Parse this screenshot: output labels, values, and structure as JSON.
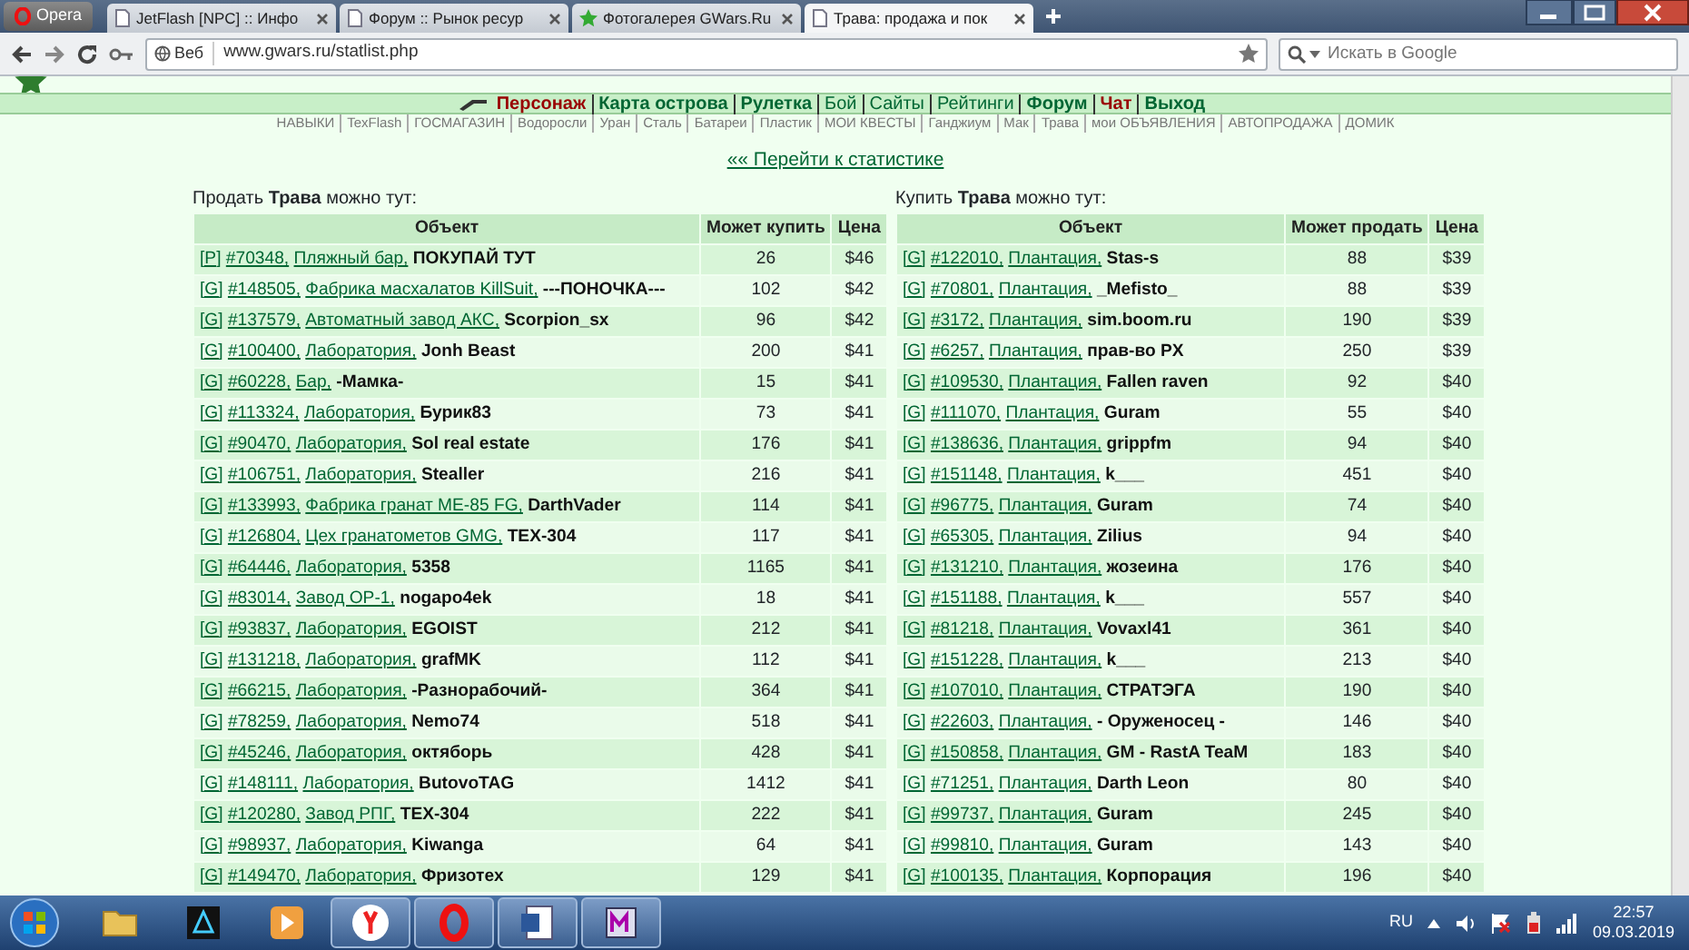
{
  "browser": {
    "opera_button": "Opera",
    "tabs": [
      {
        "title": "JetFlash [NPC] :: Инфо",
        "kind": "page",
        "selected": false
      },
      {
        "title": "Форум :: Рынок ресур",
        "kind": "page",
        "selected": false
      },
      {
        "title": "Фотогалерея GWars.Ru",
        "kind": "star",
        "selected": false
      },
      {
        "title": "Трава: продажа и пок",
        "kind": "page",
        "selected": true
      }
    ],
    "address": {
      "badge": "Веб",
      "url": "www.gwars.ru/statlist.php"
    },
    "search": {
      "placeholder": "Искать в Google"
    }
  },
  "nav": {
    "main": [
      {
        "label": "Персонаж",
        "kind": "alert"
      },
      {
        "label": "Карта острова",
        "kind": "main"
      },
      {
        "label": "Рулетка",
        "kind": "main"
      },
      {
        "label": "Бой",
        "kind": "minor"
      },
      {
        "label": "Сайты",
        "kind": "minor"
      },
      {
        "label": "Рейтинги",
        "kind": "minor"
      },
      {
        "label": "Форум",
        "kind": "main"
      },
      {
        "label": "Чат",
        "kind": "alert"
      },
      {
        "label": "Выход",
        "kind": "main"
      }
    ],
    "sub": [
      "НАВЫКИ",
      "TexFlash",
      "ГОСМАГАЗИН",
      "Водоросли",
      "Уран",
      "Сталь",
      "Батареи",
      "Пластик",
      "МОИ КВЕСТЫ",
      "Ганджиум",
      "Мак",
      "Трава",
      "мои ОБЪЯВЛЕНИЯ",
      "АВТОПРОДАЖА",
      "ДОМИК"
    ]
  },
  "stats_link": "«« Перейти к статистике",
  "sell": {
    "heading": "Продать **Трава** можно тут:",
    "columns": [
      "Объект",
      "Может купить",
      "Цена"
    ],
    "rows": [
      {
        "tag": "[P]",
        "id": "#70348,",
        "place": "Пляжный бар,",
        "owner": "ПОКУПАЙ ТУТ",
        "count": "26",
        "price": "$46"
      },
      {
        "tag": "[G]",
        "id": "#148505,",
        "place": "Фабрика масхалатов KillSuit,",
        "owner": "---ПОНОЧКА---",
        "count": "102",
        "price": "$42"
      },
      {
        "tag": "[G]",
        "id": "#137579,",
        "place": "Автоматный завод АКС,",
        "owner": "Scorpion_sx",
        "count": "96",
        "price": "$42"
      },
      {
        "tag": "[G]",
        "id": "#100400,",
        "place": "Лаборатория,",
        "owner": "Jonh Beast",
        "count": "200",
        "price": "$41"
      },
      {
        "tag": "[G]",
        "id": "#60228,",
        "place": "Бар,",
        "owner": "-Мамка-",
        "count": "15",
        "price": "$41"
      },
      {
        "tag": "[G]",
        "id": "#113324,",
        "place": "Лаборатория,",
        "owner": "Бурик83",
        "count": "73",
        "price": "$41"
      },
      {
        "tag": "[G]",
        "id": "#90470,",
        "place": "Лаборатория,",
        "owner": "Sol real estate",
        "count": "176",
        "price": "$41"
      },
      {
        "tag": "[G]",
        "id": "#106751,",
        "place": "Лаборатория,",
        "owner": "Stealler",
        "count": "216",
        "price": "$41"
      },
      {
        "tag": "[G]",
        "id": "#133993,",
        "place": "Фабрика гранат МЕ-85 FG,",
        "owner": "DarthVader",
        "count": "114",
        "price": "$41"
      },
      {
        "tag": "[G]",
        "id": "#126804,",
        "place": "Цех гранатометов GMG,",
        "owner": "TEX-304",
        "count": "117",
        "price": "$41"
      },
      {
        "tag": "[G]",
        "id": "#64446,",
        "place": "Лаборатория,",
        "owner": "5358",
        "count": "1165",
        "price": "$41"
      },
      {
        "tag": "[G]",
        "id": "#83014,",
        "place": "Завод ОР-1,",
        "owner": "nogapo4ek",
        "count": "18",
        "price": "$41"
      },
      {
        "tag": "[G]",
        "id": "#93837,",
        "place": "Лаборатория,",
        "owner": "EGOIST",
        "count": "212",
        "price": "$41"
      },
      {
        "tag": "[G]",
        "id": "#131218,",
        "place": "Лаборатория,",
        "owner": "grafMK",
        "count": "112",
        "price": "$41"
      },
      {
        "tag": "[G]",
        "id": "#66215,",
        "place": "Лаборатория,",
        "owner": "-Разнорабочий-",
        "count": "364",
        "price": "$41"
      },
      {
        "tag": "[G]",
        "id": "#78259,",
        "place": "Лаборатория,",
        "owner": "Nemo74",
        "count": "518",
        "price": "$41"
      },
      {
        "tag": "[G]",
        "id": "#45246,",
        "place": "Лаборатория,",
        "owner": "октяборь",
        "count": "428",
        "price": "$41"
      },
      {
        "tag": "[G]",
        "id": "#148111,",
        "place": "Лаборатория,",
        "owner": "ButovoTAG",
        "count": "1412",
        "price": "$41"
      },
      {
        "tag": "[G]",
        "id": "#120280,",
        "place": "Завод РПГ,",
        "owner": "TEX-304",
        "count": "222",
        "price": "$41"
      },
      {
        "tag": "[G]",
        "id": "#98937,",
        "place": "Лаборатория,",
        "owner": "Kiwanga",
        "count": "64",
        "price": "$41"
      },
      {
        "tag": "[G]",
        "id": "#149470,",
        "place": "Лаборатория,",
        "owner": "Фризотех",
        "count": "129",
        "price": "$41"
      }
    ]
  },
  "buy": {
    "heading": "Купить **Трава** можно тут:",
    "columns": [
      "Объект",
      "Может продать",
      "Цена"
    ],
    "rows": [
      {
        "tag": "[G]",
        "id": "#122010,",
        "place": "Плантация,",
        "owner": "Stas-s",
        "count": "88",
        "price": "$39"
      },
      {
        "tag": "[G]",
        "id": "#70801,",
        "place": "Плантация,",
        "owner": "_Mefisto_",
        "count": "88",
        "price": "$39"
      },
      {
        "tag": "[G]",
        "id": "#3172,",
        "place": "Плантация,",
        "owner": "sim.boom.ru",
        "count": "190",
        "price": "$39"
      },
      {
        "tag": "[G]",
        "id": "#6257,",
        "place": "Плантация,",
        "owner": "прав-во PX",
        "count": "250",
        "price": "$39"
      },
      {
        "tag": "[G]",
        "id": "#109530,",
        "place": "Плантация,",
        "owner": "Fallen raven",
        "count": "92",
        "price": "$40"
      },
      {
        "tag": "[G]",
        "id": "#111070,",
        "place": "Плантация,",
        "owner": "Guram",
        "count": "55",
        "price": "$40"
      },
      {
        "tag": "[G]",
        "id": "#138636,",
        "place": "Плантация,",
        "owner": "grippfm",
        "count": "94",
        "price": "$40"
      },
      {
        "tag": "[G]",
        "id": "#151148,",
        "place": "Плантация,",
        "owner": "k___",
        "count": "451",
        "price": "$40"
      },
      {
        "tag": "[G]",
        "id": "#96775,",
        "place": "Плантация,",
        "owner": "Guram",
        "count": "74",
        "price": "$40"
      },
      {
        "tag": "[G]",
        "id": "#65305,",
        "place": "Плантация,",
        "owner": "Zilius",
        "count": "94",
        "price": "$40"
      },
      {
        "tag": "[G]",
        "id": "#131210,",
        "place": "Плантация,",
        "owner": "жозеина",
        "count": "176",
        "price": "$40"
      },
      {
        "tag": "[G]",
        "id": "#151188,",
        "place": "Плантация,",
        "owner": "k___",
        "count": "557",
        "price": "$40"
      },
      {
        "tag": "[G]",
        "id": "#81218,",
        "place": "Плантация,",
        "owner": "Vovaxl41",
        "count": "361",
        "price": "$40"
      },
      {
        "tag": "[G]",
        "id": "#151228,",
        "place": "Плантация,",
        "owner": "k___",
        "count": "213",
        "price": "$40"
      },
      {
        "tag": "[G]",
        "id": "#107010,",
        "place": "Плантация,",
        "owner": "СТРАТЭГА",
        "count": "190",
        "price": "$40"
      },
      {
        "tag": "[G]",
        "id": "#22603,",
        "place": "Плантация,",
        "owner": "- Оруженосец -",
        "count": "146",
        "price": "$40"
      },
      {
        "tag": "[G]",
        "id": "#150858,",
        "place": "Плантация,",
        "owner": "GM - RastA TeaM",
        "count": "183",
        "price": "$40"
      },
      {
        "tag": "[G]",
        "id": "#71251,",
        "place": "Плантация,",
        "owner": "Darth Leon",
        "count": "80",
        "price": "$40"
      },
      {
        "tag": "[G]",
        "id": "#99737,",
        "place": "Плантация,",
        "owner": "Guram",
        "count": "245",
        "price": "$40"
      },
      {
        "tag": "[G]",
        "id": "#99810,",
        "place": "Плантация,",
        "owner": "Guram",
        "count": "143",
        "price": "$40"
      },
      {
        "tag": "[G]",
        "id": "#100135,",
        "place": "Плантация,",
        "owner": "Корпорация",
        "count": "196",
        "price": "$40"
      }
    ]
  },
  "taskbar": {
    "apps": [
      {
        "kind": "folder",
        "running": false
      },
      {
        "kind": "app",
        "running": false
      },
      {
        "kind": "media",
        "running": false
      },
      {
        "kind": "yandex",
        "running": true
      },
      {
        "kind": "opera",
        "running": true
      },
      {
        "kind": "word",
        "running": true
      },
      {
        "kind": "tool",
        "running": true
      }
    ],
    "language": "RU",
    "time": "22:57",
    "date": "09.03.2019"
  }
}
